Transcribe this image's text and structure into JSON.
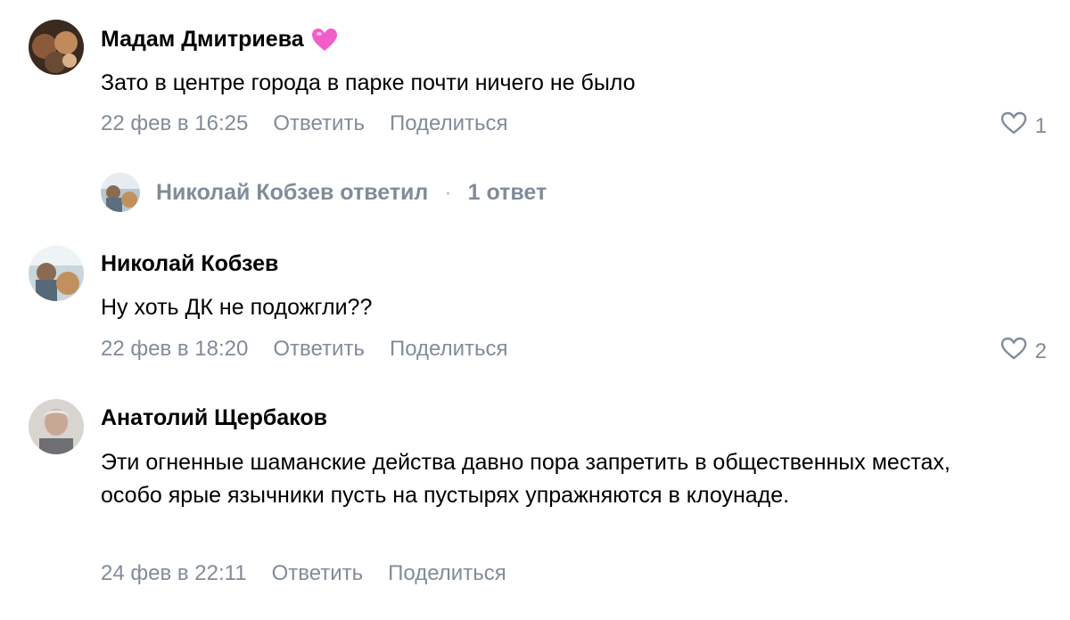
{
  "comments": [
    {
      "author": "Мадам Дмитриева",
      "author_emoji": "pink-heart-emoji",
      "text": "Зато в центре города в парке почти ничего не было",
      "date": "22 фев в 16:25",
      "reply_label": "Ответить",
      "share_label": "Поделиться",
      "likes": "1",
      "replies": {
        "author_text": "Николай Кобзев ответил",
        "separator": "·",
        "count_text": "1 ответ"
      }
    },
    {
      "author": "Николай Кобзев",
      "text": "Ну хоть ДК не подожгли??",
      "date": "22 фев в 18:20",
      "reply_label": "Ответить",
      "share_label": "Поделиться",
      "likes": "2"
    },
    {
      "author": "Анатолий Щербаков",
      "text": "Эти огненные шаманские действа давно пора запретить в общественных местах, особо ярые язычники пусть на пустырях упражняются в клоунаде.",
      "date": "24 фев в 22:11",
      "reply_label": "Ответить",
      "share_label": "Поделиться"
    }
  ],
  "colors": {
    "secondary_text": "#818c99",
    "heart_emoji": "#f05fc8"
  },
  "icons": [
    "heart-outline-icon",
    "pink-heart-emoji"
  ]
}
